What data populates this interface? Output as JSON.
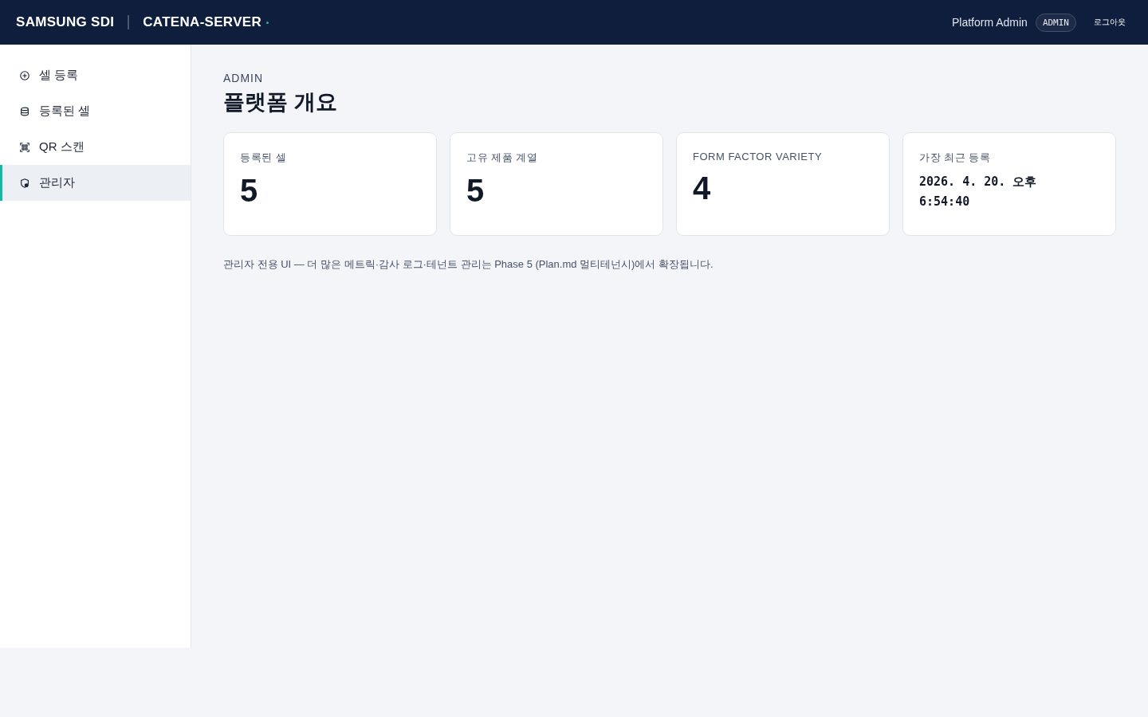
{
  "header": {
    "brand": "SAMSUNG SDI",
    "product": "CATENA-SERVER",
    "user": "Platform Admin",
    "role_badge": "ADMIN",
    "logout": "로그아웃"
  },
  "sidebar": {
    "items": [
      {
        "label": "셀 등록",
        "kind": "add",
        "selected": false
      },
      {
        "label": "등록된 셀",
        "kind": "database",
        "selected": false
      },
      {
        "label": "QR 스캔",
        "kind": "qr",
        "selected": false
      },
      {
        "label": "관리자",
        "kind": "admin",
        "selected": true
      }
    ]
  },
  "page": {
    "eyebrow": "ADMIN",
    "title": "플랫폼 개요"
  },
  "stats": [
    {
      "label": "등록된 셀",
      "value": "5",
      "kind": "number"
    },
    {
      "label": "고유 제품 계열",
      "value": "5",
      "kind": "number"
    },
    {
      "label": "FORM FACTOR VARIETY",
      "value": "4",
      "kind": "number"
    },
    {
      "label": "가장 최근 등록",
      "value": "2026. 4. 20. 오후 6:54:40",
      "kind": "datetime"
    }
  ],
  "note": "관리자 전용 UI — 더 많은 메트릭·감사 로그·테넌트 관리는 Phase 5 (Plan.md 멀티테넌시)에서 확장됩니다."
}
